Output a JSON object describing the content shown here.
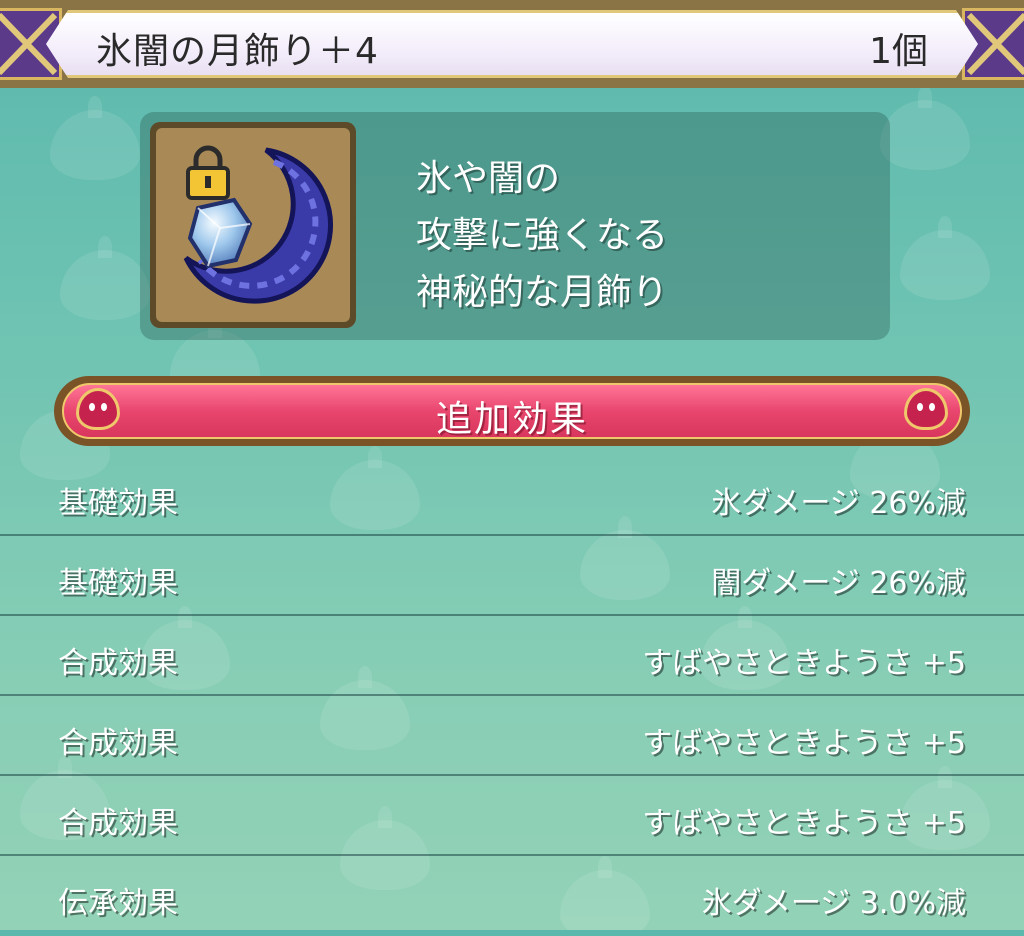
{
  "header": {
    "item_name": "氷闇の月飾り＋4",
    "item_count": "1個"
  },
  "item": {
    "icon": "crescent-moon-accessory-icon",
    "lock_icon": "lock-icon",
    "description_lines": [
      "氷や闇の",
      "攻撃に強くなる",
      "神秘的な月飾り"
    ]
  },
  "section": {
    "title": "追加効果"
  },
  "effects": [
    {
      "label": "基礎効果",
      "value": "氷ダメージ 26%減"
    },
    {
      "label": "基礎効果",
      "value": "闇ダメージ 26%減"
    },
    {
      "label": "合成効果",
      "value": "すばやさときようさ +5"
    },
    {
      "label": "合成効果",
      "value": "すばやさときようさ +5"
    },
    {
      "label": "合成効果",
      "value": "すばやさときようさ +5"
    },
    {
      "label": "伝承効果",
      "value": "氷ダメージ 3.0%減"
    }
  ],
  "colors": {
    "background": "#6ec3b2",
    "banner": "#e9466e",
    "header_frame": "#5b3a8a",
    "gold": "#e0c77a"
  }
}
